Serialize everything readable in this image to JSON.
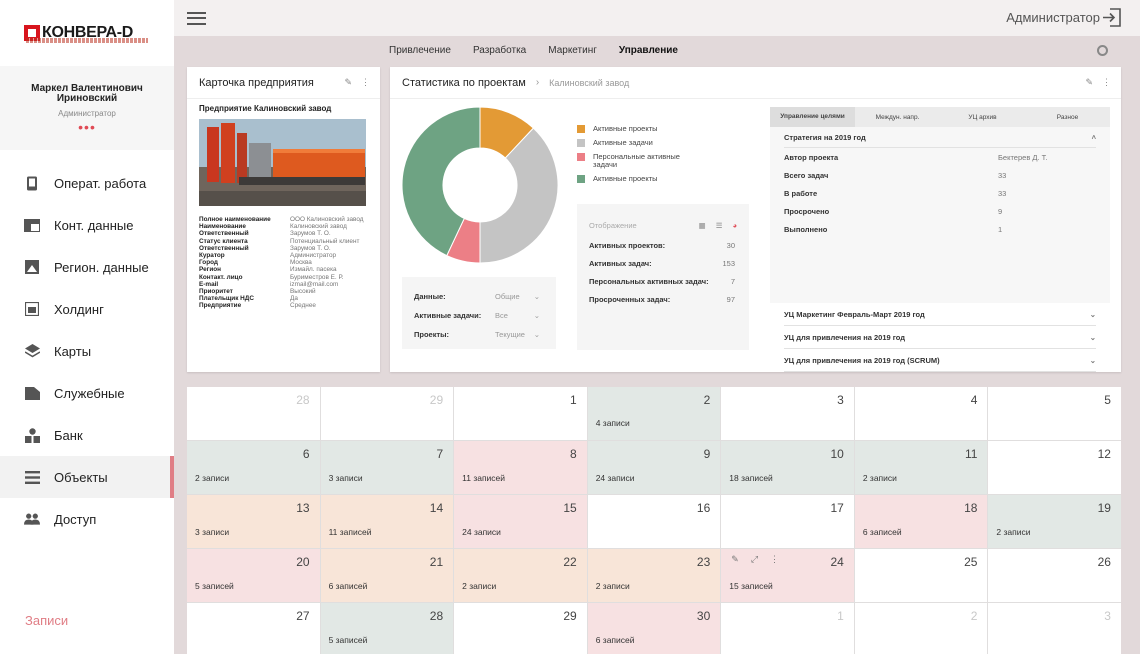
{
  "brand": {
    "name": "КОНВЕРА-D"
  },
  "profile": {
    "name": "Маркел Валентинович Ириновский",
    "role": "Администратор",
    "dots": "•••"
  },
  "nav": [
    {
      "label": "Операт. работа",
      "icon": "phone-icon"
    },
    {
      "label": "Конт. данные",
      "icon": "card-icon"
    },
    {
      "label": "Регион. данные",
      "icon": "map-region-icon"
    },
    {
      "label": "Холдинг",
      "icon": "holding-icon"
    },
    {
      "label": "Карты",
      "icon": "layers-icon"
    },
    {
      "label": "Служебные",
      "icon": "folder-icon"
    },
    {
      "label": "Банк",
      "icon": "shapes-icon"
    },
    {
      "label": "Объекты",
      "icon": "list-icon",
      "active": true
    },
    {
      "label": "Доступ",
      "icon": "people-icon"
    }
  ],
  "sidebar_footer": {
    "records": "Записи"
  },
  "topbar": {
    "admin": "Администратор"
  },
  "tabs": [
    "Привлечение",
    "Разработка",
    "Маркетинг",
    "Управление"
  ],
  "active_tab": "Управление",
  "company_card": {
    "title": "Карточка предприятия",
    "company": "Предприятие Калиновский завод",
    "details": [
      {
        "k": "Полное наименование",
        "v": "ООО Калиновский завод"
      },
      {
        "k": "Наименование",
        "v": "Калиновский завод"
      },
      {
        "k": "Ответственный",
        "v": "Зарумов Т. О."
      },
      {
        "k": "Статус клиента",
        "v": "Потенциальный клиент"
      },
      {
        "k": "Ответственный",
        "v": "Зарумов Т. О."
      },
      {
        "k": "Куратор",
        "v": "Администратор"
      },
      {
        "k": "Город",
        "v": "Москва"
      },
      {
        "k": "Регион",
        "v": "Измайл. пасека"
      },
      {
        "k": "Контакт. лицо",
        "v": "Буриместров Е. Р."
      },
      {
        "k": "E-mail",
        "v": "izmail@mail.com"
      },
      {
        "k": "Приоритет",
        "v": "Высокий"
      },
      {
        "k": "Плательщик НДС",
        "v": "Да"
      },
      {
        "k": "Предприятие",
        "v": "Среднее"
      }
    ]
  },
  "stats_card": {
    "title": "Статистика по проектам",
    "crumb": "Калиновский завод",
    "legend": [
      {
        "label": "Активные проекты",
        "color": "#e39a35"
      },
      {
        "label": "Активные задачи",
        "color": "#c4c4c4"
      },
      {
        "label": "Персональные активные задачи",
        "color": "#ec7f86"
      },
      {
        "label": "Активные проекты",
        "color": "#6ea383"
      }
    ],
    "filters": [
      {
        "k": "Данные:",
        "v": "Общие"
      },
      {
        "k": "Активные задачи:",
        "v": "Все"
      },
      {
        "k": "Проекты:",
        "v": "Текущие"
      }
    ],
    "display_label": "Отображение",
    "stats": [
      {
        "k": "Активных проектов:",
        "v": "30"
      },
      {
        "k": "Активных задач:",
        "v": "153"
      },
      {
        "k": "Персональных активных задач:",
        "v": "7"
      },
      {
        "k": "Просроченных задач:",
        "v": "97"
      }
    ],
    "goal_tabs": [
      "Управление целями",
      "Междун. напр.",
      "УЦ архив",
      "Разное"
    ],
    "strategy": {
      "title": "Стратегия на 2019 год",
      "rows": [
        {
          "k": "Автор проекта",
          "v": "Бектерев Д. Т."
        },
        {
          "k": "Всего задач",
          "v": "33"
        },
        {
          "k": "В работе",
          "v": "33"
        },
        {
          "k": "Просрочено",
          "v": "9"
        },
        {
          "k": "Выполнено",
          "v": "1"
        }
      ]
    },
    "accordions": [
      "УЦ Маркетинг Февраль-Март 2019 год",
      "УЦ для привлечения на 2019 год",
      "УЦ для привлечения на 2019 год (SCRUM)"
    ]
  },
  "chart_data": {
    "type": "pie",
    "labels": [
      "Активные проекты",
      "Активные задачи",
      "Персональные активные задачи",
      "Активные проекты"
    ],
    "values": [
      12,
      38,
      7,
      43
    ],
    "colors": [
      "#e39a35",
      "#c4c4c4",
      "#ec7f86",
      "#6ea383"
    ]
  },
  "calendar": [
    {
      "d": "28",
      "t": "dim"
    },
    {
      "d": "29",
      "t": "dim"
    },
    {
      "d": "1",
      "t": ""
    },
    {
      "d": "2",
      "t": "green",
      "r": "4 записи",
      "top": true
    },
    {
      "d": "3",
      "t": ""
    },
    {
      "d": "4",
      "t": ""
    },
    {
      "d": "5",
      "t": ""
    },
    {
      "d": "6",
      "t": "green",
      "r": "2 записи"
    },
    {
      "d": "7",
      "t": "green",
      "r": "3 записи"
    },
    {
      "d": "8",
      "t": "pink",
      "r": "11 записей"
    },
    {
      "d": "9",
      "t": "green",
      "r": "24 записи"
    },
    {
      "d": "10",
      "t": "green",
      "r": "18 записей"
    },
    {
      "d": "11",
      "t": "green",
      "r": "2 записи"
    },
    {
      "d": "12",
      "t": ""
    },
    {
      "d": "13",
      "t": "peach",
      "r": "3 записи"
    },
    {
      "d": "14",
      "t": "peach",
      "r": "11 записей"
    },
    {
      "d": "15",
      "t": "pink",
      "r": "24 записи"
    },
    {
      "d": "16",
      "t": ""
    },
    {
      "d": "17",
      "t": ""
    },
    {
      "d": "18",
      "t": "pink",
      "r": "6 записей"
    },
    {
      "d": "19",
      "t": "green",
      "r": "2 записи"
    },
    {
      "d": "20",
      "t": "pink",
      "r": "5 записей"
    },
    {
      "d": "21",
      "t": "peach",
      "r": "6 записей"
    },
    {
      "d": "22",
      "t": "peach",
      "r": "2 записи"
    },
    {
      "d": "23",
      "t": "peach",
      "r": "2 записи"
    },
    {
      "d": "24",
      "t": "pink",
      "r": "15 записей",
      "tools": true
    },
    {
      "d": "25",
      "t": ""
    },
    {
      "d": "26",
      "t": ""
    },
    {
      "d": "27",
      "t": ""
    },
    {
      "d": "28",
      "t": "green",
      "r": "5 записей"
    },
    {
      "d": "29",
      "t": ""
    },
    {
      "d": "30",
      "t": "pink",
      "r": "6 записей"
    },
    {
      "d": "1",
      "t": "dim"
    },
    {
      "d": "2",
      "t": "dim"
    },
    {
      "d": "3",
      "t": "dim"
    }
  ]
}
